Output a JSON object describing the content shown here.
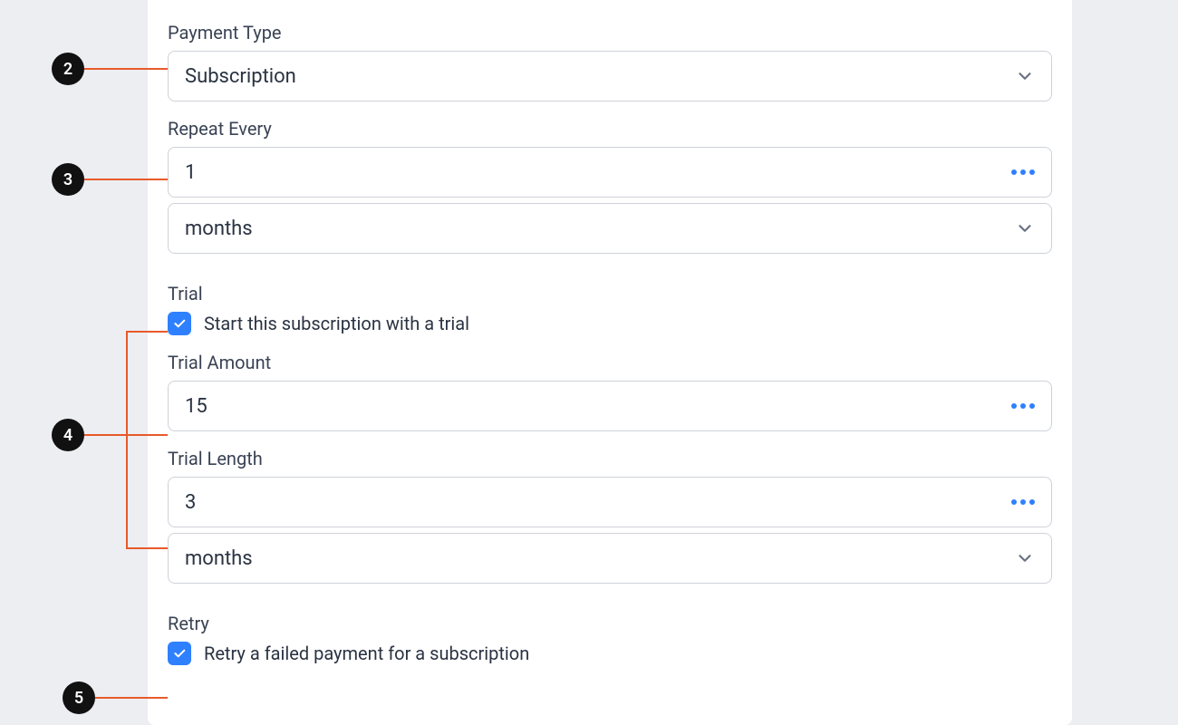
{
  "annotations": {
    "2": "2",
    "3": "3",
    "4": "4",
    "5": "5"
  },
  "payment_type": {
    "label": "Payment Type",
    "value": "Subscription"
  },
  "repeat_every": {
    "label": "Repeat Every",
    "value": "1",
    "unit": "months"
  },
  "trial": {
    "label": "Trial",
    "checkbox_label": "Start this subscription with a trial",
    "checked": true
  },
  "trial_amount": {
    "label": "Trial Amount",
    "value": "15"
  },
  "trial_length": {
    "label": "Trial Length",
    "value": "3",
    "unit": "months"
  },
  "retry": {
    "label": "Retry",
    "checkbox_label": "Retry a failed payment for a subscription",
    "checked": true
  }
}
